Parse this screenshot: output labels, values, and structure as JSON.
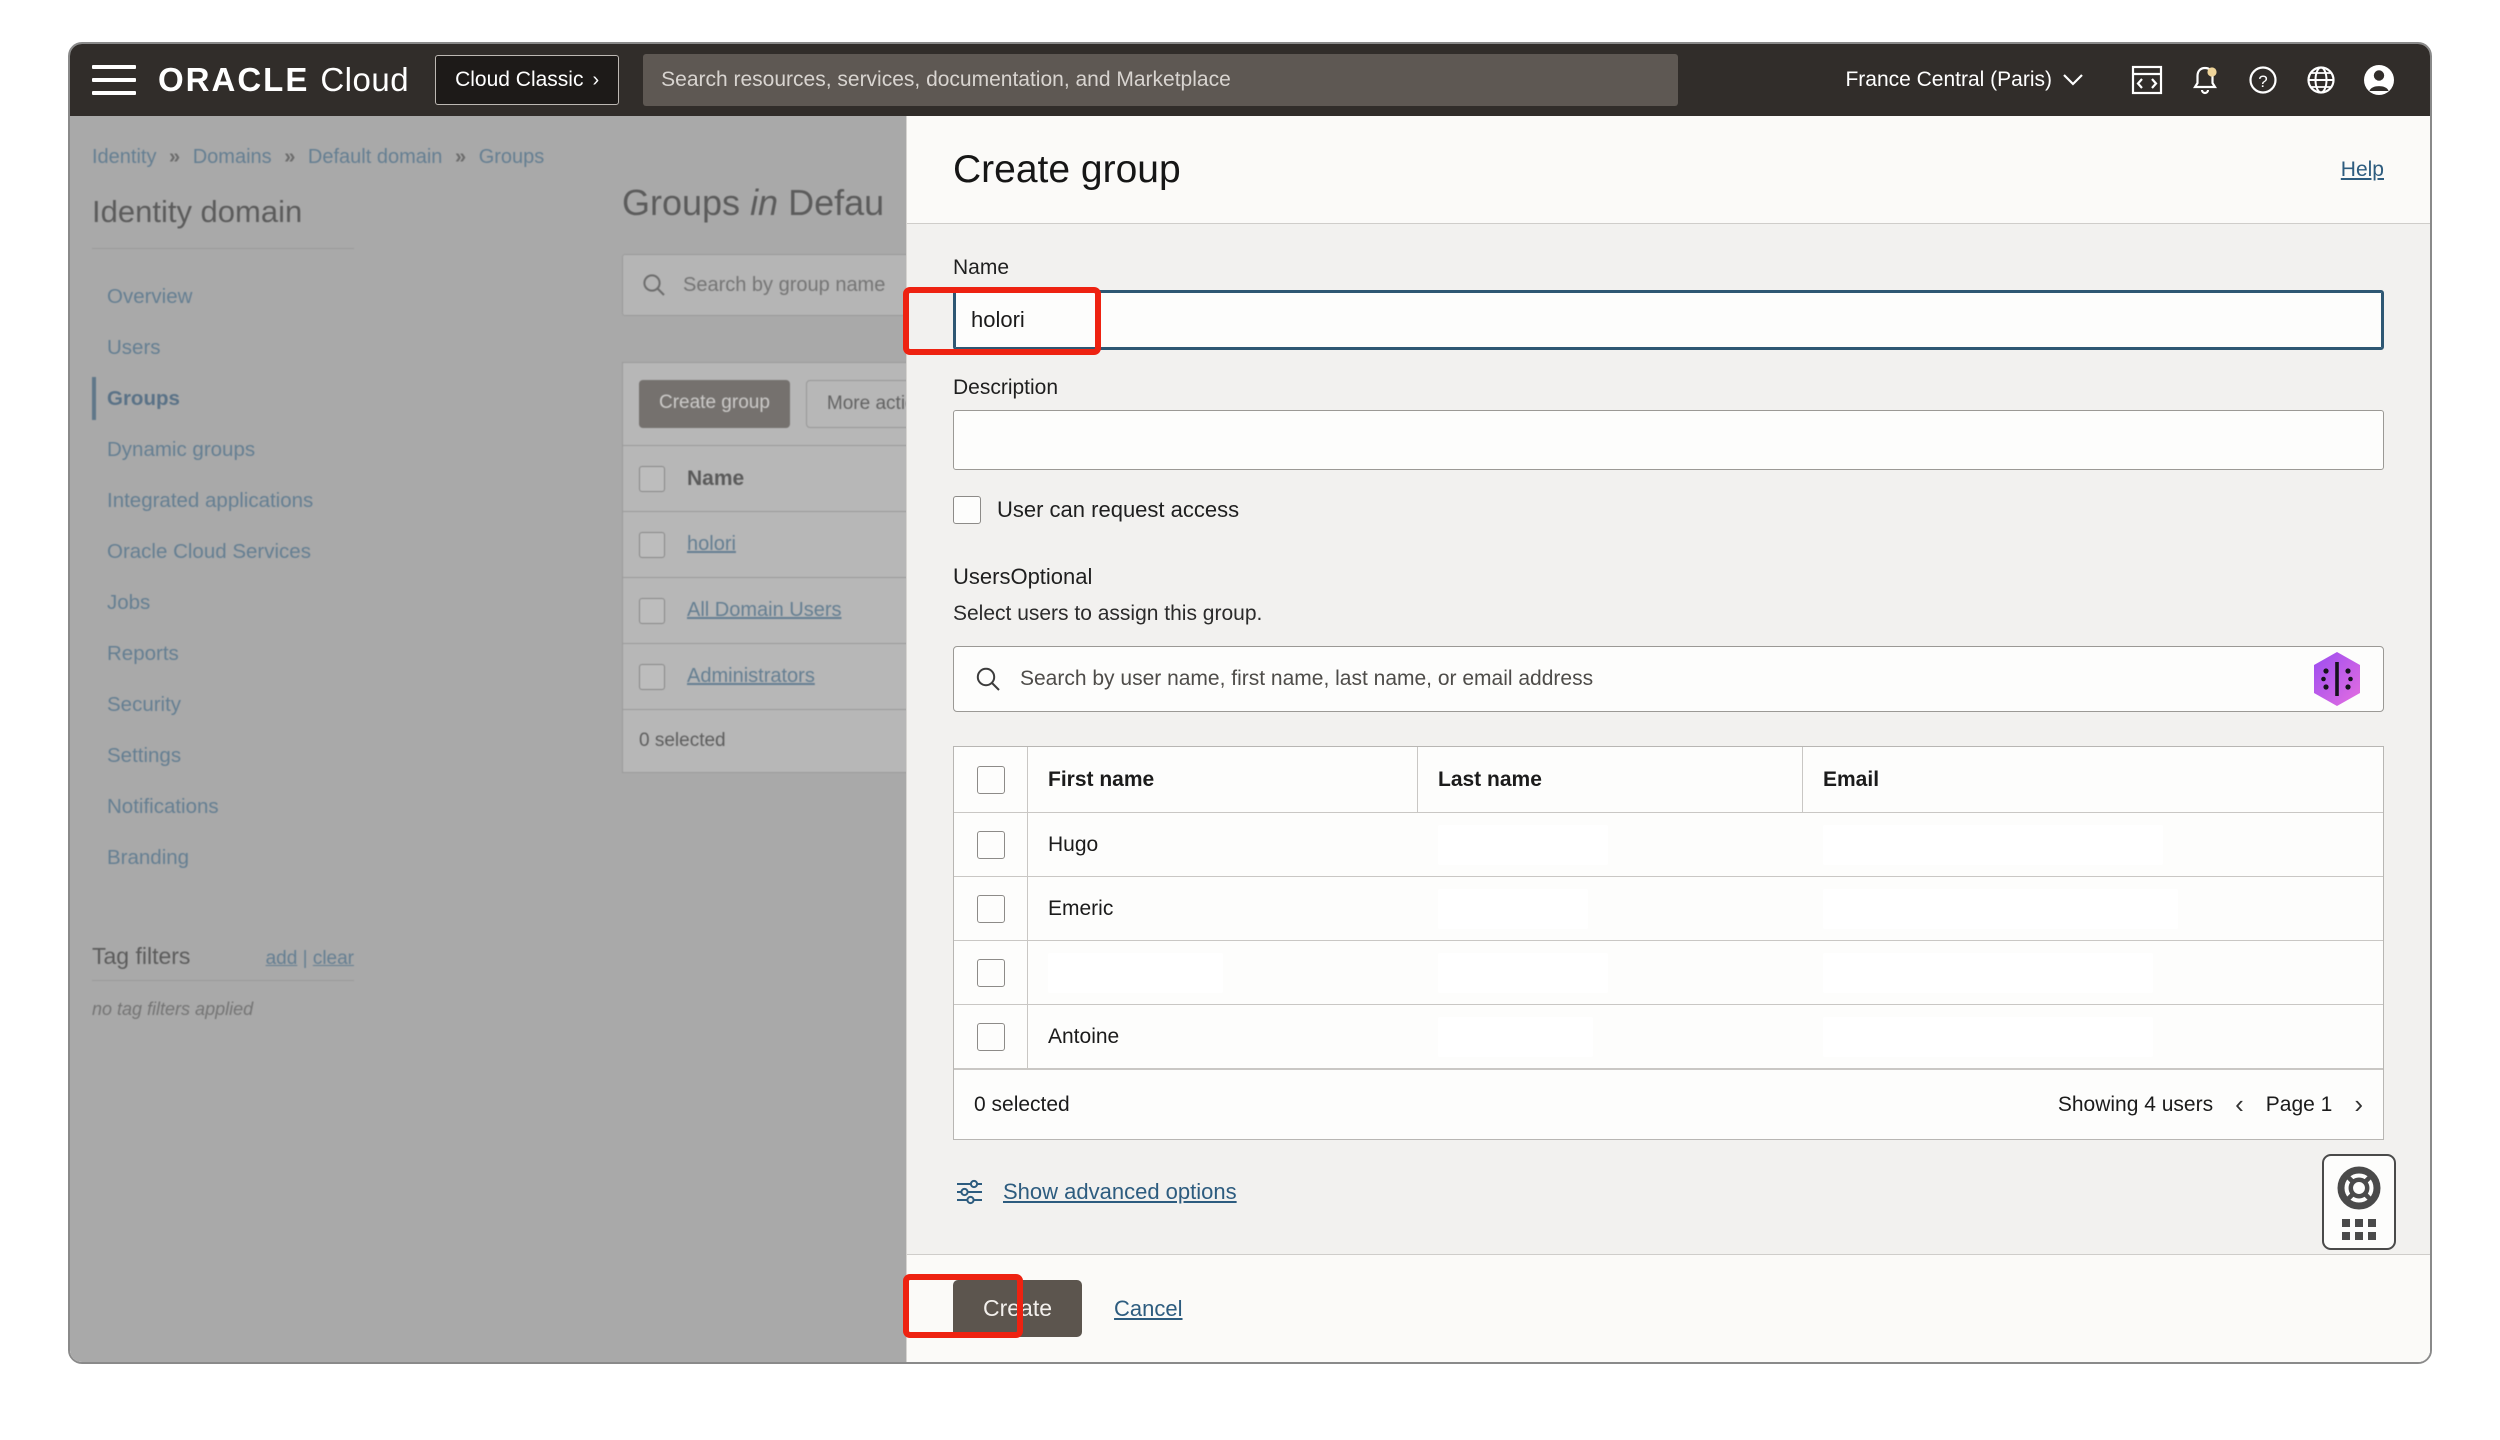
{
  "topbar": {
    "brand_oracle": "ORACLE",
    "brand_cloud": "Cloud",
    "cloud_classic_label": "Cloud Classic",
    "cloud_classic_chevron": "›",
    "search_placeholder": "Search resources, services, documentation, and Marketplace",
    "search_value": "",
    "region_label": "France Central (Paris)",
    "region_chevron": "∨",
    "icons": [
      "hamburger-icon",
      "cloud-shell-icon",
      "notifications-bell-icon",
      "help-question-icon",
      "language-globe-icon",
      "user-avatar-icon"
    ],
    "notification_dot_color": "#efd49a"
  },
  "breadcrumb": {
    "items": [
      "Identity",
      "Domains",
      "Default domain",
      "Groups"
    ],
    "separator": "»"
  },
  "sidebar": {
    "title": "Identity domain",
    "items": [
      {
        "label": "Overview",
        "active": false
      },
      {
        "label": "Users",
        "active": false
      },
      {
        "label": "Groups",
        "active": true
      },
      {
        "label": "Dynamic groups",
        "active": false
      },
      {
        "label": "Integrated applications",
        "active": false
      },
      {
        "label": "Oracle Cloud Services",
        "active": false
      },
      {
        "label": "Jobs",
        "active": false
      },
      {
        "label": "Reports",
        "active": false
      },
      {
        "label": "Security",
        "active": false
      },
      {
        "label": "Settings",
        "active": false
      },
      {
        "label": "Notifications",
        "active": false
      },
      {
        "label": "Branding",
        "active": false
      }
    ],
    "tag_filters": {
      "title": "Tag filters",
      "add_label": "add",
      "divider": "|",
      "clear_label": "clear",
      "empty_note": "no tag filters applied"
    }
  },
  "main_behind": {
    "heading_prefix": "Groups ",
    "heading_italic": "in",
    "heading_suffix": " Defau",
    "search_placeholder": "Search by group name",
    "create_group_label": "Create group",
    "more_actions_label": "More actio",
    "column_name": "Name",
    "rows": [
      "holori",
      "All Domain Users",
      "Administrators"
    ],
    "selected_label": "0 selected"
  },
  "panel": {
    "title": "Create group",
    "help_label": "Help",
    "name": {
      "label": "Name",
      "value": "holori",
      "placeholder": ""
    },
    "description": {
      "label": "Description",
      "value": "",
      "placeholder": ""
    },
    "request_access": {
      "label": "User can request access",
      "checked": false
    },
    "users": {
      "label": "Users",
      "optional_tag": "Optional",
      "subtitle": "Select users to assign this group.",
      "search_placeholder": "Search by user name, first name, last name, or email address",
      "search_value": "",
      "badge_icon": "holori-hex-badge-icon",
      "badge_color_start": "#a855f7",
      "badge_color_end": "#e06de0",
      "columns": [
        "First name",
        "Last name",
        "Email"
      ],
      "rows": [
        {
          "first_name": "Hugo",
          "last_name": "",
          "email": ""
        },
        {
          "first_name": "Emeric",
          "last_name": "",
          "email": ""
        },
        {
          "first_name": "",
          "last_name": "",
          "email": ""
        },
        {
          "first_name": "Antoine",
          "last_name": "",
          "email": ""
        }
      ],
      "selected_label": "0 selected",
      "showing_label": "Showing 4 users",
      "page_label": "Page 1",
      "prev_arrow": "‹",
      "next_arrow": "›"
    },
    "advanced": {
      "link_label": "Show advanced options",
      "icon": "sliders-icon"
    },
    "footer": {
      "create_label": "Create",
      "cancel_label": "Cancel"
    }
  },
  "help_widget": {
    "icon": "lifebuoy-icon",
    "grid_icon": "apps-grid-icon"
  },
  "annotations": {
    "highlight_color": "#ee2211",
    "targets": [
      "name-input",
      "create-button"
    ]
  }
}
